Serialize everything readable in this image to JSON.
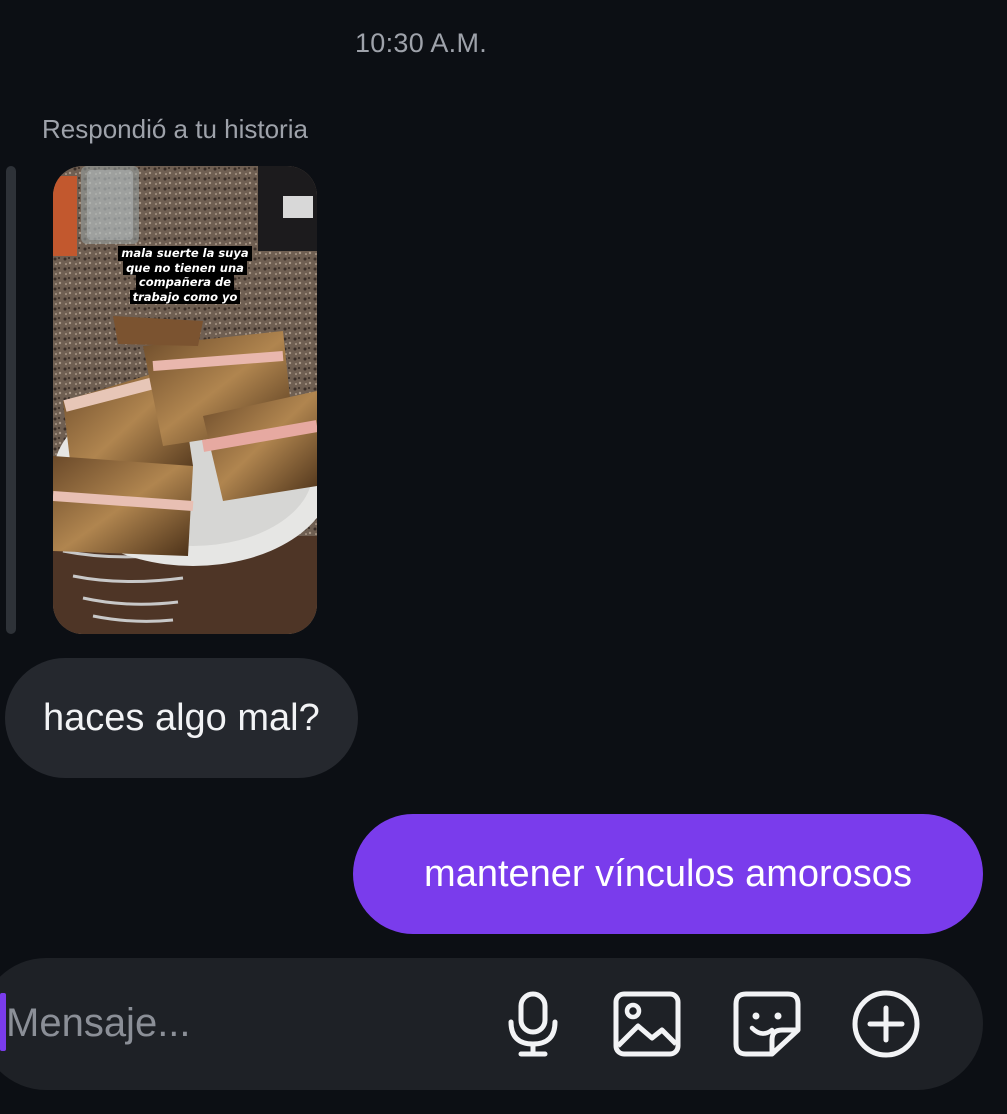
{
  "chat": {
    "timestamp": "10:30 A.M.",
    "reply_label": "Respondió a tu historia",
    "story": {
      "caption_lines": [
        "mala suerte la suya",
        "que no tienen una",
        "compañera de",
        "trabajo como yo"
      ]
    },
    "messages": [
      {
        "direction": "incoming",
        "text": "haces algo mal?"
      },
      {
        "direction": "outgoing",
        "text": "mantener vínculos amorosos"
      }
    ]
  },
  "composer": {
    "placeholder": "Mensaje...",
    "icons": [
      "microphone-icon",
      "image-icon",
      "sticker-icon",
      "plus-circle-icon"
    ]
  },
  "colors": {
    "background": "#0c0f14",
    "incoming_bubble": "#25282e",
    "outgoing_bubble": "#7a3cec",
    "composer": "#1e2126",
    "muted_text": "#9ea2aa"
  }
}
